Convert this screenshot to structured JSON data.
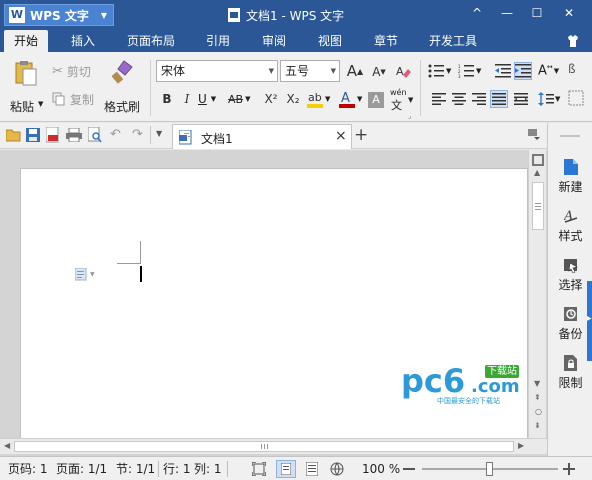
{
  "app": {
    "menu_label": "WPS 文字",
    "window_title": "文档1 - WPS 文字"
  },
  "window_controls": {
    "collapse": "^",
    "minimize": "—",
    "maximize": "☐",
    "close": "✕"
  },
  "tabs": [
    "开始",
    "插入",
    "页面布局",
    "引用",
    "审阅",
    "视图",
    "章节",
    "开发工具"
  ],
  "active_tab": "开始",
  "ribbon": {
    "paste": "粘贴",
    "cut": "剪切",
    "copy": "复制",
    "format_painter": "格式刷",
    "font_name": "宋体",
    "font_size": "五号",
    "bold": "B",
    "italic": "I",
    "underline": "U",
    "strikethrough": "AB",
    "superscript": "X²",
    "subscript": "X₂",
    "grow_font": "A",
    "shrink_font": "A",
    "phonetic": "wén"
  },
  "document_tab": {
    "title": "文档1",
    "close": "×",
    "new_tab": "+"
  },
  "side_pane": [
    {
      "label": "新建",
      "icon": "new-doc-icon"
    },
    {
      "label": "样式",
      "icon": "style-icon"
    },
    {
      "label": "选择",
      "icon": "select-icon"
    },
    {
      "label": "备份",
      "icon": "backup-icon"
    },
    {
      "label": "限制",
      "icon": "restrict-icon"
    }
  ],
  "status": {
    "page_num": "页码: 1",
    "page_count": "页面: 1/1",
    "section": "节: 1/1",
    "row": "行: 1",
    "col": "列: 1",
    "zoom": "100 %"
  },
  "zoom_level": 0.5,
  "watermark": {
    "brand_main": "pc6",
    "brand_com": ".com",
    "badge": "下载站",
    "tagline": "中国最安全的下载站"
  },
  "colors": {
    "title_bg": "#2b5797",
    "accent": "#2b78d4",
    "highlight": "#f5d000",
    "font_color": "#c00000"
  }
}
